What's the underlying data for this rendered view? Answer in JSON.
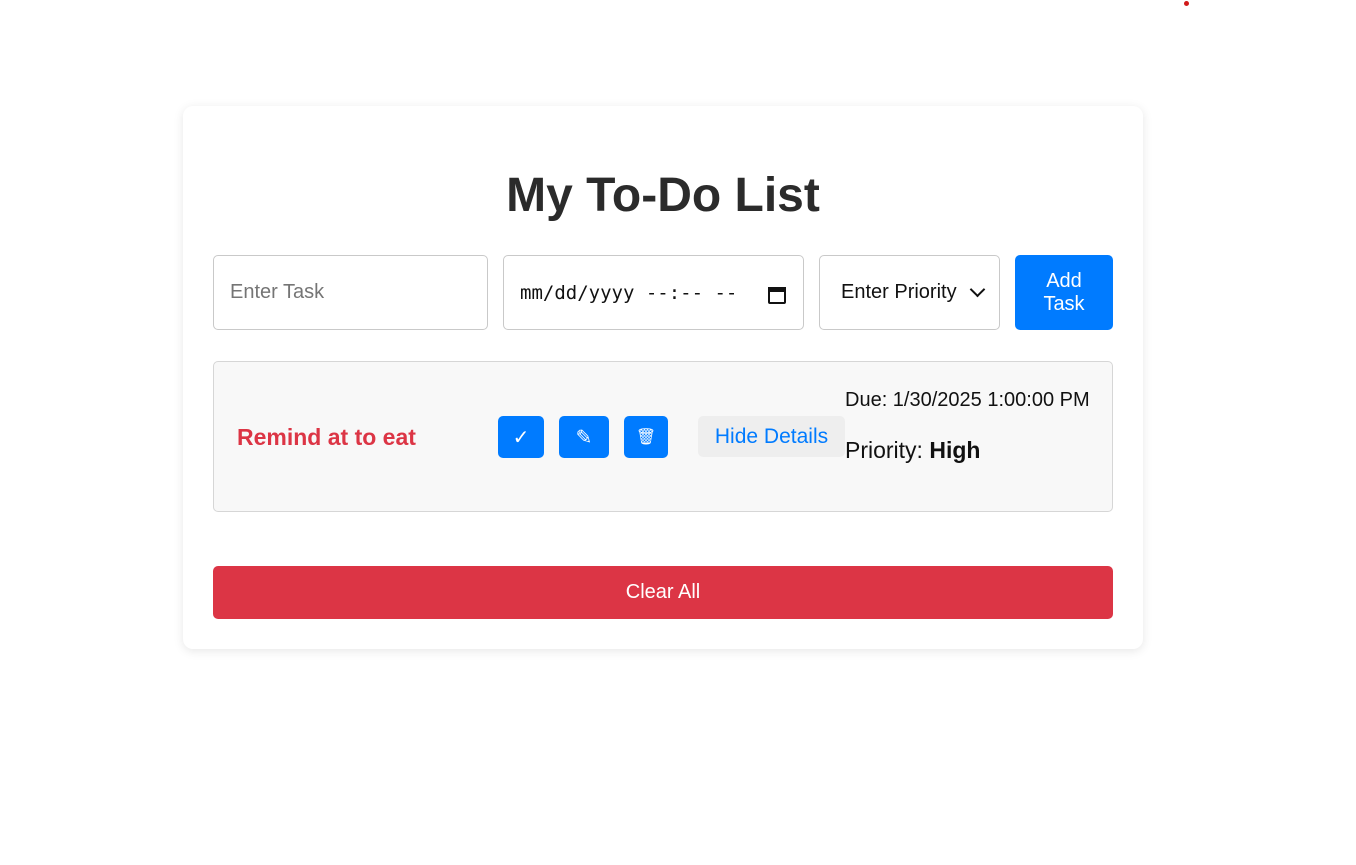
{
  "app": {
    "title": "My To-Do List"
  },
  "form": {
    "task_placeholder": "Enter Task",
    "date_placeholder": "mm/dd/yyyy --:-- --",
    "priority_selected": "Enter Priority",
    "add_label": "Add Task"
  },
  "tasks": [
    {
      "name": "Remind at to eat",
      "complete_icon": "✓",
      "edit_icon": "✎",
      "delete_icon": "🗑",
      "details_label": "Hide Details",
      "due_text": "Due: 1/30/2025 1:00:00 PM",
      "priority_label": "Priority: ",
      "priority_value": "High"
    }
  ],
  "actions": {
    "clear_label": "Clear All"
  },
  "colors": {
    "primary": "#007bff",
    "danger": "#dc3545",
    "card_bg": "#ffffff",
    "task_bg": "#f8f8f8"
  }
}
